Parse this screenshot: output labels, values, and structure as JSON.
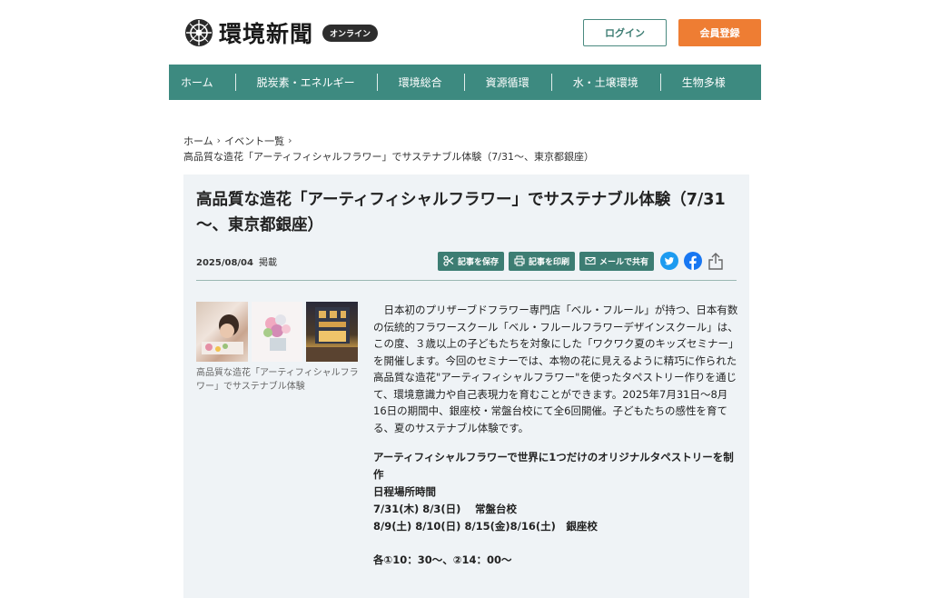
{
  "header": {
    "logo_text": "環境新聞",
    "logo_badge": "オンライン",
    "login_label": "ログイン",
    "register_label": "会員登録"
  },
  "nav": {
    "items": [
      "ホーム",
      "脱炭素・エネルギー",
      "環境総合",
      "資源循環",
      "水・土壌環境",
      "生物多様"
    ]
  },
  "breadcrumb": {
    "home": "ホーム",
    "events": "イベント一覧",
    "current": "高品質な造花「アーティフィシャルフラワー」でサステナブル体験（7/31～、東京都銀座）"
  },
  "article": {
    "title": "高品質な造花「アーティフィシャルフラワー」でサステナブル体験（7/31～、東京都銀座）",
    "date": "2025/08/04",
    "posted": "掲載",
    "tools": {
      "save": "記事を保存",
      "print": "記事を印刷",
      "mail": "メールで共有"
    },
    "caption": "高品質な造花「アーティフィシャルフラワー」でサステナブル体験",
    "body": "日本初のプリザーブドフラワー専門店「ベル・フルール」が持つ、日本有数の伝統的フラワースクール「ベル・フルールフラワーデザインスクール」は、この度、３歳以上の子どもたちを対象にした「ワクワク夏のキッズセミナー」を開催します。今回のセミナーでは、本物の花に見えるように精巧に作られた高品質な造花\"アーティフィシャルフラワー\"を使ったタペストリー作りを通じて、環境意識力や自己表現力を育むことができます。2025年7月31日～8月16日の期間中、銀座校・常盤台校にて全6回開催。子どもたちの感性を育てる、夏のサステナブル体験です。",
    "section_title": "アーティフィシャルフラワーで世界に1つだけのオリジナルタペストリーを制作",
    "schedule_label": "日程場所時間",
    "schedule_1": "7/31(木) 8/3(日)　 常盤台校",
    "schedule_2": "8/9(土) 8/10(日) 8/15(金)8/16(土)　銀座校",
    "times": "各①10：30～、②14：00～"
  },
  "colors": {
    "brand_green": "#3d8a80",
    "accent_orange": "#ee7d33",
    "article_bg": "#eff3f6"
  }
}
